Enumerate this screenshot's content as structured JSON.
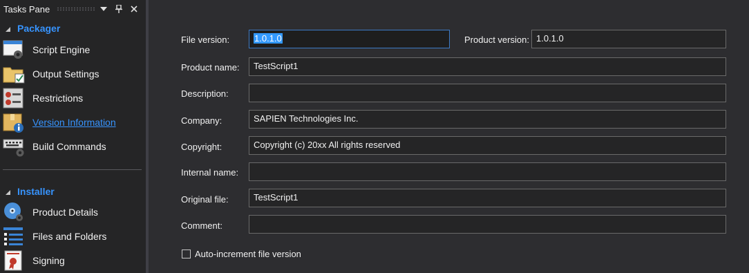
{
  "pane": {
    "title": "Tasks Pane",
    "groups": [
      {
        "label": "Packager",
        "items": [
          {
            "label": "Script Engine",
            "icon": "script-engine-icon"
          },
          {
            "label": "Output Settings",
            "icon": "output-settings-icon"
          },
          {
            "label": "Restrictions",
            "icon": "restrictions-icon"
          },
          {
            "label": "Version Information",
            "icon": "version-info-icon",
            "selected": true
          },
          {
            "label": "Build Commands",
            "icon": "build-commands-icon"
          }
        ]
      },
      {
        "label": "Installer",
        "items": [
          {
            "label": "Product Details",
            "icon": "product-details-icon"
          },
          {
            "label": "Files and Folders",
            "icon": "files-folders-icon"
          },
          {
            "label": "Signing",
            "icon": "signing-icon"
          }
        ]
      }
    ]
  },
  "form": {
    "file_version_label": "File version:",
    "file_version": "1.0.1.0",
    "product_version_label": "Product version:",
    "product_version": "1.0.1.0",
    "product_name_label": "Product name:",
    "product_name": "TestScript1",
    "description_label": "Description:",
    "description": "",
    "company_label": "Company:",
    "company": "SAPIEN Technologies Inc.",
    "copyright_label": "Copyright:",
    "copyright": "Copyright (c) 20xx All rights reserved",
    "internal_name_label": "Internal name:",
    "internal_name": "",
    "original_file_label": "Original file:",
    "original_file": "TestScript1",
    "comment_label": "Comment:",
    "comment": "",
    "auto_increment_label": "Auto-increment file version",
    "auto_increment_checked": false
  },
  "colors": {
    "accent": "#3794ff",
    "background": "#2d2d30",
    "pane_background": "#252526",
    "selection": "#3399ff"
  }
}
